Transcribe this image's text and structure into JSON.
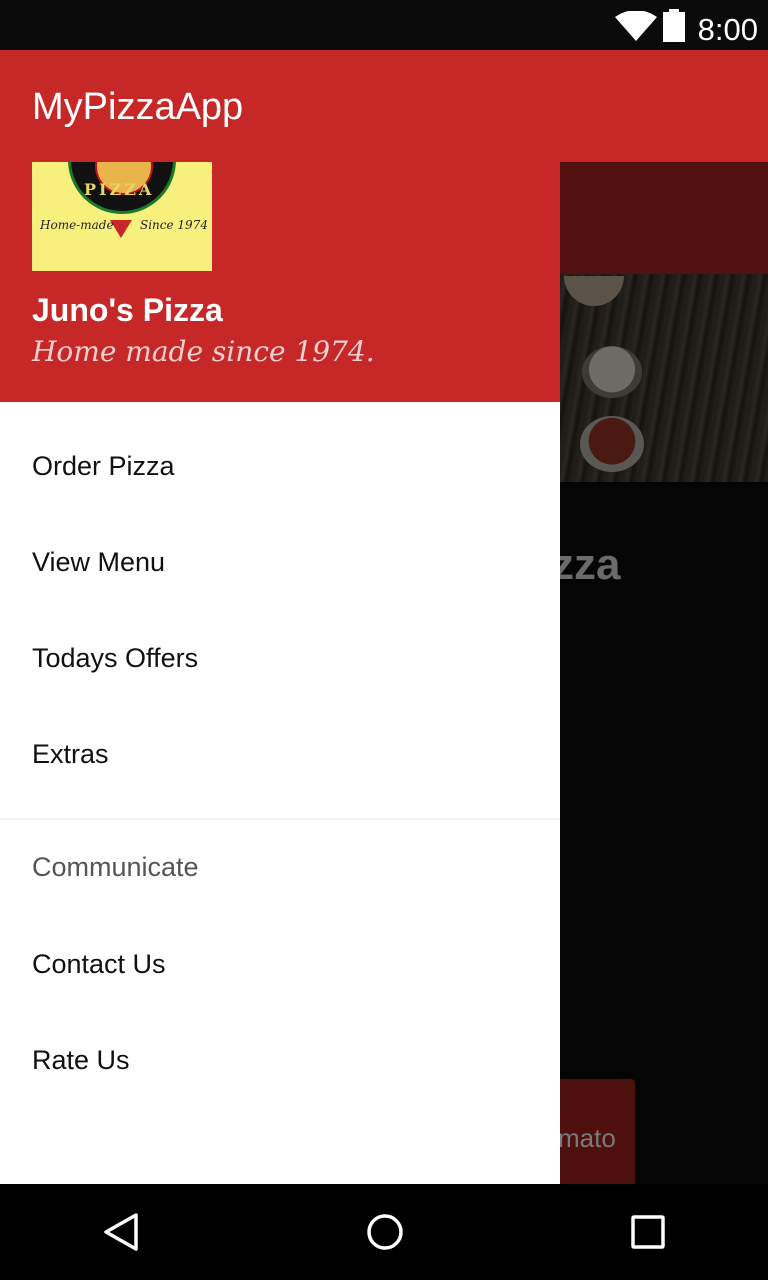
{
  "status_bar": {
    "time": "8:00",
    "wifi_icon": "wifi-icon",
    "battery_icon": "battery-icon"
  },
  "app_bar": {
    "title": "MyPizzaApp"
  },
  "drawer": {
    "logo": {
      "brand": "PIZZA",
      "left_text": "Home-made",
      "right_text": "Since 1974"
    },
    "shop_name": "Juno's Pizza",
    "tagline": "Home made since 1974.",
    "items": [
      {
        "label": "Order Pizza"
      },
      {
        "label": "View Menu"
      },
      {
        "label": "Todays Offers"
      },
      {
        "label": "Extras"
      }
    ],
    "section_title": "Communicate",
    "section_items": [
      {
        "label": "Contact Us"
      },
      {
        "label": "Rate Us"
      }
    ]
  },
  "background": {
    "heading_fragment": "zza",
    "button_fragment": "mato"
  },
  "nav_bar": {
    "back_icon": "back-icon",
    "home_icon": "home-icon",
    "recents_icon": "recents-icon"
  },
  "colors": {
    "primary": "#c62828",
    "drawer_bg": "#ffffff",
    "scrim": "#000000"
  }
}
